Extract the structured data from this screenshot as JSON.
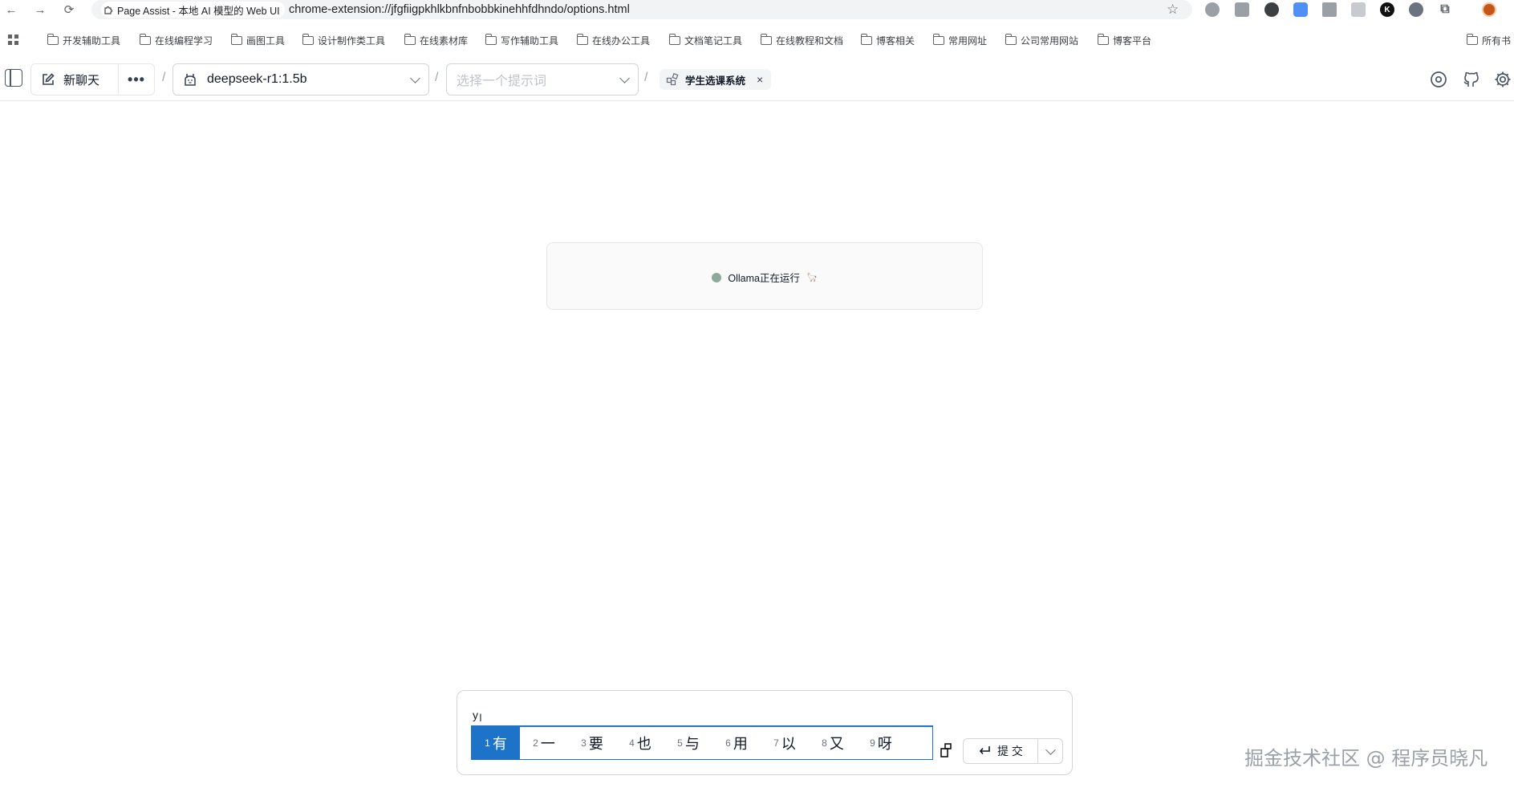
{
  "browser": {
    "tab_title": "Page Assist - 本地 AI 模型的 Web UI",
    "url": "chrome-extension://jfgfiigpkhlkbnfnbobbkinehhfdhndo/options.html",
    "bookmarks": [
      "开发辅助工具",
      "在线编程学习",
      "画图工具",
      "设计制作类工具",
      "在线素材库",
      "写作辅助工具",
      "在线办公工具",
      "文档笔记工具",
      "在线教程和文档",
      "博客相关",
      "常用网址",
      "公司常用网站",
      "博客平台"
    ],
    "all_bookmarks": "所有书"
  },
  "toolbar": {
    "new_chat": "新聊天",
    "more": "•••",
    "model": "deepseek-r1:1.5b",
    "prompt_placeholder": "选择一个提示词",
    "knowledge_tag": "学生选课系统",
    "knowledge_close": "×"
  },
  "status": {
    "text": "Ollama正在运行",
    "emoji": "🦙"
  },
  "composer": {
    "typed_text": "y",
    "submit_label": "提 交",
    "ime_candidates": [
      {
        "n": "1",
        "w": "有"
      },
      {
        "n": "2",
        "w": "一"
      },
      {
        "n": "3",
        "w": "要"
      },
      {
        "n": "4",
        "w": "也"
      },
      {
        "n": "5",
        "w": "与"
      },
      {
        "n": "6",
        "w": "用"
      },
      {
        "n": "7",
        "w": "以"
      },
      {
        "n": "8",
        "w": "又"
      },
      {
        "n": "9",
        "w": "呀"
      }
    ]
  },
  "watermark": "掘金技术社区 @ 程序员晓凡",
  "colors": {
    "ime_accent": "#1c73c7",
    "status_dot": "#8fa89c"
  }
}
